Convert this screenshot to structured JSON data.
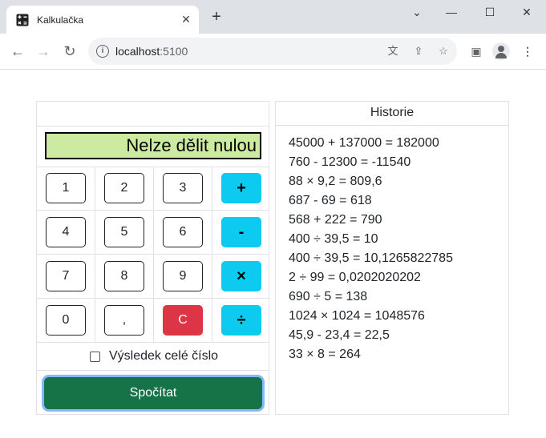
{
  "browser": {
    "tab_title": "Kalkulačka",
    "url_host": "localhost",
    "url_port": ":5100"
  },
  "calculator": {
    "display": "Nelze dělit nulou",
    "keys": [
      {
        "label": "1",
        "kind": "digit"
      },
      {
        "label": "2",
        "kind": "digit"
      },
      {
        "label": "3",
        "kind": "digit"
      },
      {
        "label": "+",
        "kind": "op"
      },
      {
        "label": "4",
        "kind": "digit"
      },
      {
        "label": "5",
        "kind": "digit"
      },
      {
        "label": "6",
        "kind": "digit"
      },
      {
        "label": "-",
        "kind": "op"
      },
      {
        "label": "7",
        "kind": "digit"
      },
      {
        "label": "8",
        "kind": "digit"
      },
      {
        "label": "9",
        "kind": "digit"
      },
      {
        "label": "×",
        "kind": "op"
      },
      {
        "label": "0",
        "kind": "digit"
      },
      {
        "label": ",",
        "kind": "digit"
      },
      {
        "label": "C",
        "kind": "clear"
      },
      {
        "label": "÷",
        "kind": "op"
      }
    ],
    "integer_result_label": "Výsledek celé číslo",
    "integer_result_checked": false,
    "submit_label": "Spočítat"
  },
  "history": {
    "title": "Historie",
    "entries": [
      "45000 + 137000 = 182000",
      "760 - 12300 = -11540",
      "88 × 9,2 = 809,6",
      "687 - 69 = 618",
      "568 + 222 = 790",
      "400 ÷ 39,5 = 10",
      "400 ÷ 39,5 = 10,1265822785",
      "2 ÷ 99 = 0,0202020202",
      "690 ÷ 5 = 138",
      "1024 × 1024 = 1048576",
      "45,9 - 23,4 = 22,5",
      "33 × 8 = 264"
    ]
  },
  "colors": {
    "display_bg": "#cdeba0",
    "operator_key": "#0dcaf0",
    "clear_key": "#dc3545",
    "submit_button": "#157347"
  }
}
